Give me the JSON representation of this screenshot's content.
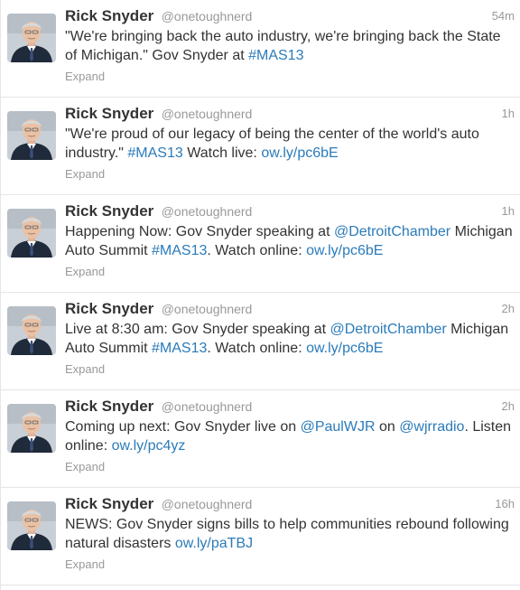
{
  "tweets": [
    {
      "name": "Rick Snyder",
      "handle": "@onetoughnerd",
      "time": "54m",
      "segments": [
        {
          "t": "\"We're bringing back the auto industry, we're bringing back the State of Michigan.\" Gov Snyder at ",
          "link": false
        },
        {
          "t": "#MAS13",
          "link": true
        }
      ],
      "expand": "Expand"
    },
    {
      "name": "Rick Snyder",
      "handle": "@onetoughnerd",
      "time": "1h",
      "segments": [
        {
          "t": "\"We're proud of our legacy of being the center of the world's auto industry.\" ",
          "link": false
        },
        {
          "t": "#MAS13",
          "link": true
        },
        {
          "t": " Watch live: ",
          "link": false
        },
        {
          "t": "ow.ly/pc6bE",
          "link": true
        }
      ],
      "expand": "Expand"
    },
    {
      "name": "Rick Snyder",
      "handle": "@onetoughnerd",
      "time": "1h",
      "segments": [
        {
          "t": "Happening Now: Gov Snyder speaking at ",
          "link": false
        },
        {
          "t": "@DetroitChamber",
          "link": true
        },
        {
          "t": " Michigan Auto Summit ",
          "link": false
        },
        {
          "t": "#MAS13",
          "link": true
        },
        {
          "t": ". Watch online: ",
          "link": false
        },
        {
          "t": "ow.ly/pc6bE",
          "link": true
        }
      ],
      "expand": "Expand"
    },
    {
      "name": "Rick Snyder",
      "handle": "@onetoughnerd",
      "time": "2h",
      "segments": [
        {
          "t": "Live at 8:30 am: Gov Snyder speaking at ",
          "link": false
        },
        {
          "t": "@DetroitChamber",
          "link": true
        },
        {
          "t": " Michigan Auto Summit  ",
          "link": false
        },
        {
          "t": "#MAS13",
          "link": true
        },
        {
          "t": ". Watch online: ",
          "link": false
        },
        {
          "t": "ow.ly/pc6bE",
          "link": true
        }
      ],
      "expand": "Expand"
    },
    {
      "name": "Rick Snyder",
      "handle": "@onetoughnerd",
      "time": "2h",
      "segments": [
        {
          "t": "Coming up next: Gov Snyder live on ",
          "link": false
        },
        {
          "t": "@PaulWJR",
          "link": true
        },
        {
          "t": " on ",
          "link": false
        },
        {
          "t": "@wjrradio",
          "link": true
        },
        {
          "t": ". Listen online: ",
          "link": false
        },
        {
          "t": "ow.ly/pc4yz",
          "link": true
        }
      ],
      "expand": "Expand"
    },
    {
      "name": "Rick Snyder",
      "handle": "@onetoughnerd",
      "time": "16h",
      "segments": [
        {
          "t": "NEWS: Gov Snyder signs bills to help communities rebound following natural disasters ",
          "link": false
        },
        {
          "t": "ow.ly/paTBJ",
          "link": true
        }
      ],
      "expand": "Expand"
    }
  ]
}
